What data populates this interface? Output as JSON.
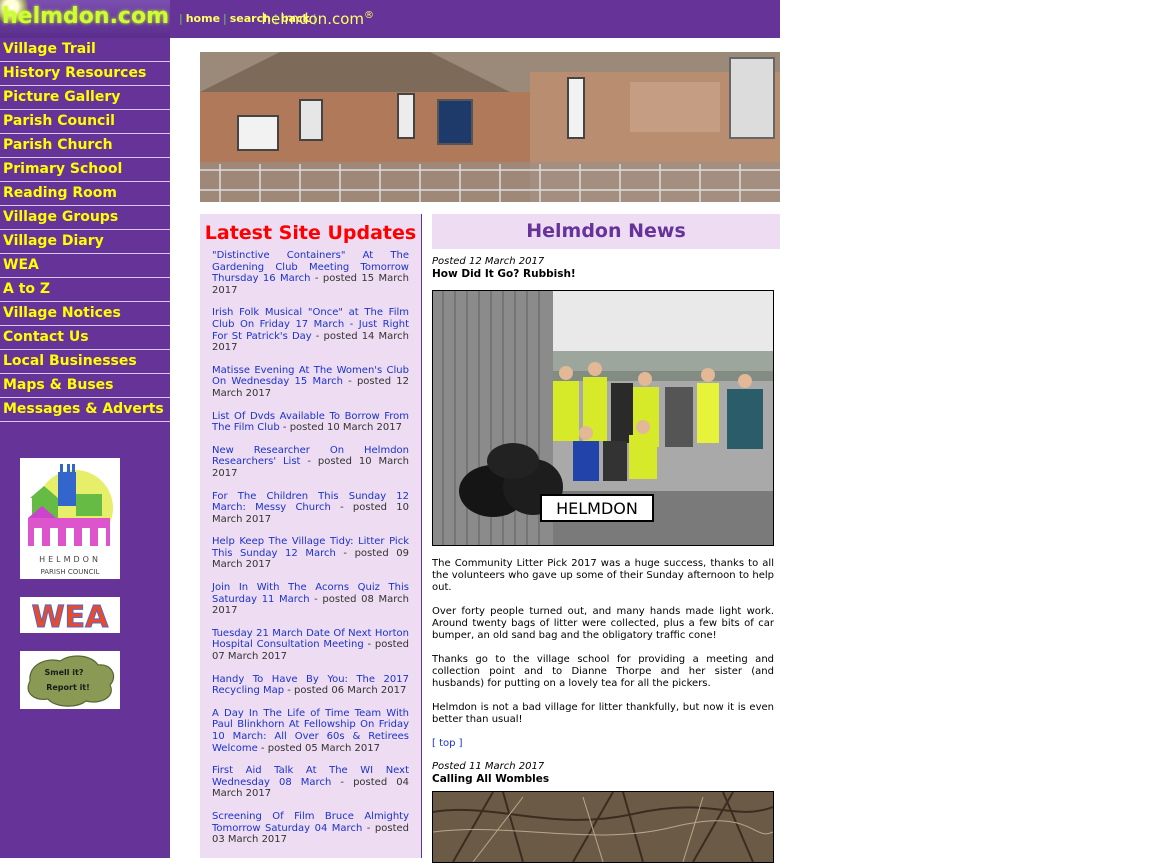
{
  "header": {
    "logo": "helmdon.com",
    "topnav": {
      "home": "home",
      "search": "search",
      "back": "back",
      "separator": "|"
    },
    "brand": "helmdon.com",
    "brand_mark": "®"
  },
  "sidebar": {
    "items": [
      "Village Trail",
      "History Resources",
      "Picture Gallery",
      "Parish Council",
      "Parish Church",
      "Primary School",
      "Reading Room",
      "Village Groups",
      "Village Diary",
      "WEA",
      "A to Z",
      "Village Notices",
      "Contact Us",
      "Local Businesses",
      "Maps & Buses",
      "Messages & Adverts"
    ],
    "logos": {
      "parish_council_top": "HELMDON",
      "parish_council_bottom": "PARISH COUNCIL",
      "wea": "WEA",
      "smell_line1": "Smell it?",
      "smell_line2": "Report it!"
    }
  },
  "updates": {
    "title": "Latest Site Updates",
    "items": [
      {
        "link": "\"Distinctive Containers\" At The Gardening Club Meeting Tomorrow Thursday 16 March",
        "posted": " - posted 15 March 2017"
      },
      {
        "link": "Irish Folk Musical \"Once\" at The Film Club On Friday 17 March - Just Right For St Patrick's Day",
        "posted": " - posted 14 March 2017"
      },
      {
        "link": "Matisse Evening At The Women's Club On Wednesday 15 March",
        "posted": " - posted 12 March 2017"
      },
      {
        "link": "List Of Dvds Available To Borrow From The Film Club",
        "posted": " - posted 10 March 2017"
      },
      {
        "link": "New Researcher On Helmdon Researchers' List",
        "posted": " - posted 10 March 2017"
      },
      {
        "link": "For The Children This Sunday 12 March: Messy Church",
        "posted": " - posted 10 March 2017"
      },
      {
        "link": "Help Keep The Village Tidy: Litter Pick This Sunday 12 March",
        "posted": " - posted 09 March 2017"
      },
      {
        "link": "Join In With The Acorns Quiz This Saturday 11 March",
        "posted": " - posted 08 March 2017"
      },
      {
        "link": "Tuesday 21 March Date Of Next Horton Hospital Consultation Meeting",
        "posted": " - posted 07 March 2017"
      },
      {
        "link": "Handy To Have By You: The 2017 Recycling Map",
        "posted": " - posted 06 March 2017"
      },
      {
        "link": "A Day In The Life of Time Team With Paul Blinkhorn At Fellowship On Friday 10 March: All Over 60s & Retirees Welcome",
        "posted": " - posted 05 March 2017"
      },
      {
        "link": "First Aid Talk At The WI Next Wednesday 08 March",
        "posted": " - posted 04 March 2017"
      },
      {
        "link": "Screening Of Film Bruce Almighty Tomorrow Saturday 04 March",
        "posted": " - posted 03 March 2017"
      }
    ]
  },
  "news": {
    "title": "Helmdon News",
    "post1": {
      "posted": "Posted 12 March 2017",
      "title": "How Did It Go? Rubbish!",
      "sign": "HELMDON",
      "paragraphs": [
        "The Community Litter Pick 2017 was a huge success, thanks to all the volunteers who gave up some of their Sunday afternoon to help out.",
        "Over forty people turned out, and many hands made light work. Around twenty bags of litter were collected, plus a few bits of car bumper, an old sand bag and the obligatory traffic cone!",
        "Thanks go to the village school for providing a meeting and collection point and to Dianne Thorpe and her sister (and husbands) for putting on a lovely tea for all the pickers.",
        "Helmdon is not a bad village for litter thankfully, but now it is even better than usual!"
      ],
      "top_link": "[ top ]"
    },
    "post2": {
      "posted": "Posted 11 March 2017",
      "title": "Calling All Wombles"
    }
  }
}
